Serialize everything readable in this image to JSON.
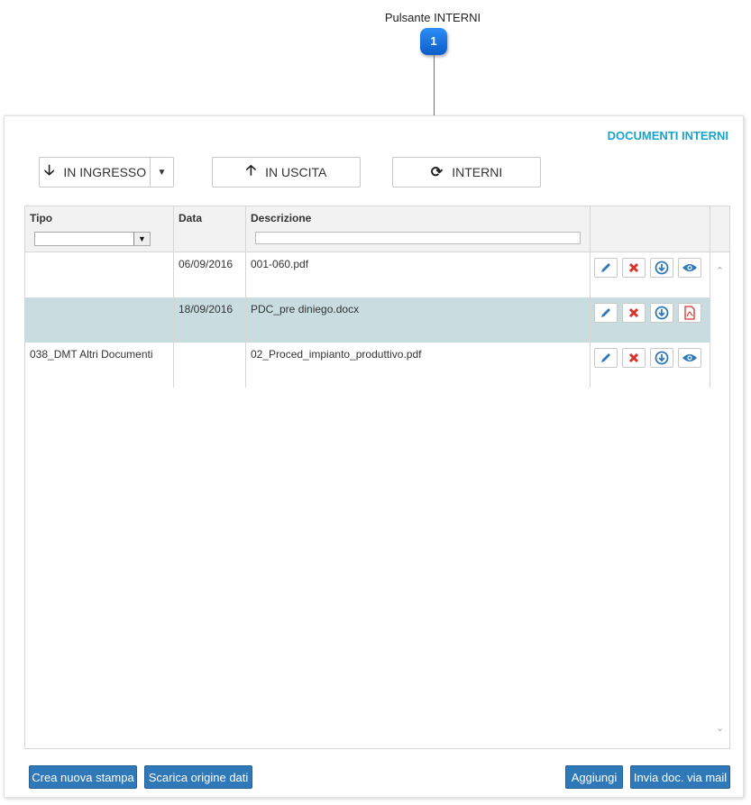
{
  "callout": {
    "label": "Pulsante INTERNI",
    "number": "1"
  },
  "panel": {
    "title": "DOCUMENTI INTERNI"
  },
  "toolbar": {
    "ingresso": "IN INGRESSO",
    "uscita": "IN USCITA",
    "interni": "INTERNI"
  },
  "columns": {
    "tipo": "Tipo",
    "data": "Data",
    "descrizione": "Descrizione"
  },
  "rows": [
    {
      "tipo": "",
      "data": "06/09/2016",
      "descrizione": "001-060.pdf",
      "preview": "eye-icon"
    },
    {
      "tipo": "",
      "data": "18/09/2016",
      "descrizione": "PDC_pre diniego.docx",
      "preview": "pdf-icon"
    },
    {
      "tipo": "038_DMT Altri Documenti",
      "data": "",
      "descrizione": "02_Proced_impianto_produttivo.pdf",
      "preview": "eye-icon"
    }
  ],
  "footer": {
    "crea": "Crea nuova stampa",
    "scarica": "Scarica origine dati",
    "aggiungi": "Aggiungi",
    "invia": "Invia doc. via mail"
  },
  "colors": {
    "accent_title": "#1aa3c9",
    "primary_button": "#2f78b9",
    "selected_row": "#c9dde0",
    "callout": "#0b5ec9"
  }
}
